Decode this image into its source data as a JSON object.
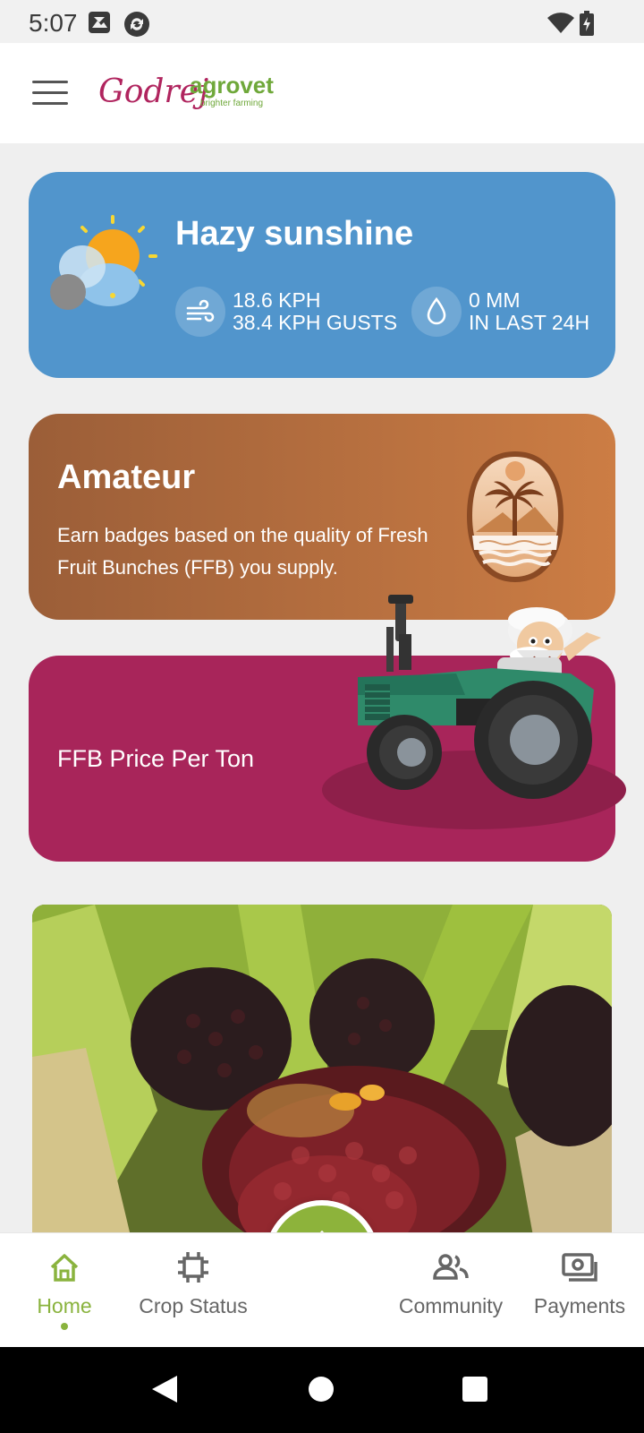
{
  "status_bar": {
    "time": "5:07",
    "icons": [
      "gallery-icon",
      "sync-icon",
      "wifi-icon",
      "battery-icon"
    ]
  },
  "app_bar": {
    "menu_icon": "hamburger-menu-icon",
    "logo_text_1": "Godrej",
    "logo_text_2": "agrovet",
    "logo_tagline": "brighter farming"
  },
  "weather": {
    "condition": "Hazy sunshine",
    "wind_speed": "18.6 KPH",
    "wind_gusts": "38.4 KPH GUSTS",
    "precip_amount": "0 MM",
    "precip_period": "IN LAST 24H",
    "icons": [
      "partly-cloudy-icon",
      "wind-icon",
      "raindrop-icon"
    ]
  },
  "badge_card": {
    "title": "Amateur",
    "description": "Earn badges based on the quality of Fresh Fruit Bunches (FFB) you supply.",
    "icon": "palm-badge-icon"
  },
  "price_card": {
    "label": "FFB Price Per Ton"
  },
  "bottom_nav": {
    "items": [
      {
        "label": "Home",
        "icon": "home-icon",
        "active": true
      },
      {
        "label": "Crop Status",
        "icon": "crop-status-icon",
        "active": false
      },
      {
        "label": "Community",
        "icon": "community-icon",
        "active": false
      },
      {
        "label": "Payments",
        "icon": "payments-icon",
        "active": false
      }
    ],
    "center_icon": "palm-logo-icon"
  },
  "colors": {
    "accent_green": "#8ab33e",
    "weather_blue": "#5195cc",
    "badge_brown": "#b66f3f",
    "price_magenta": "#a8255a"
  }
}
